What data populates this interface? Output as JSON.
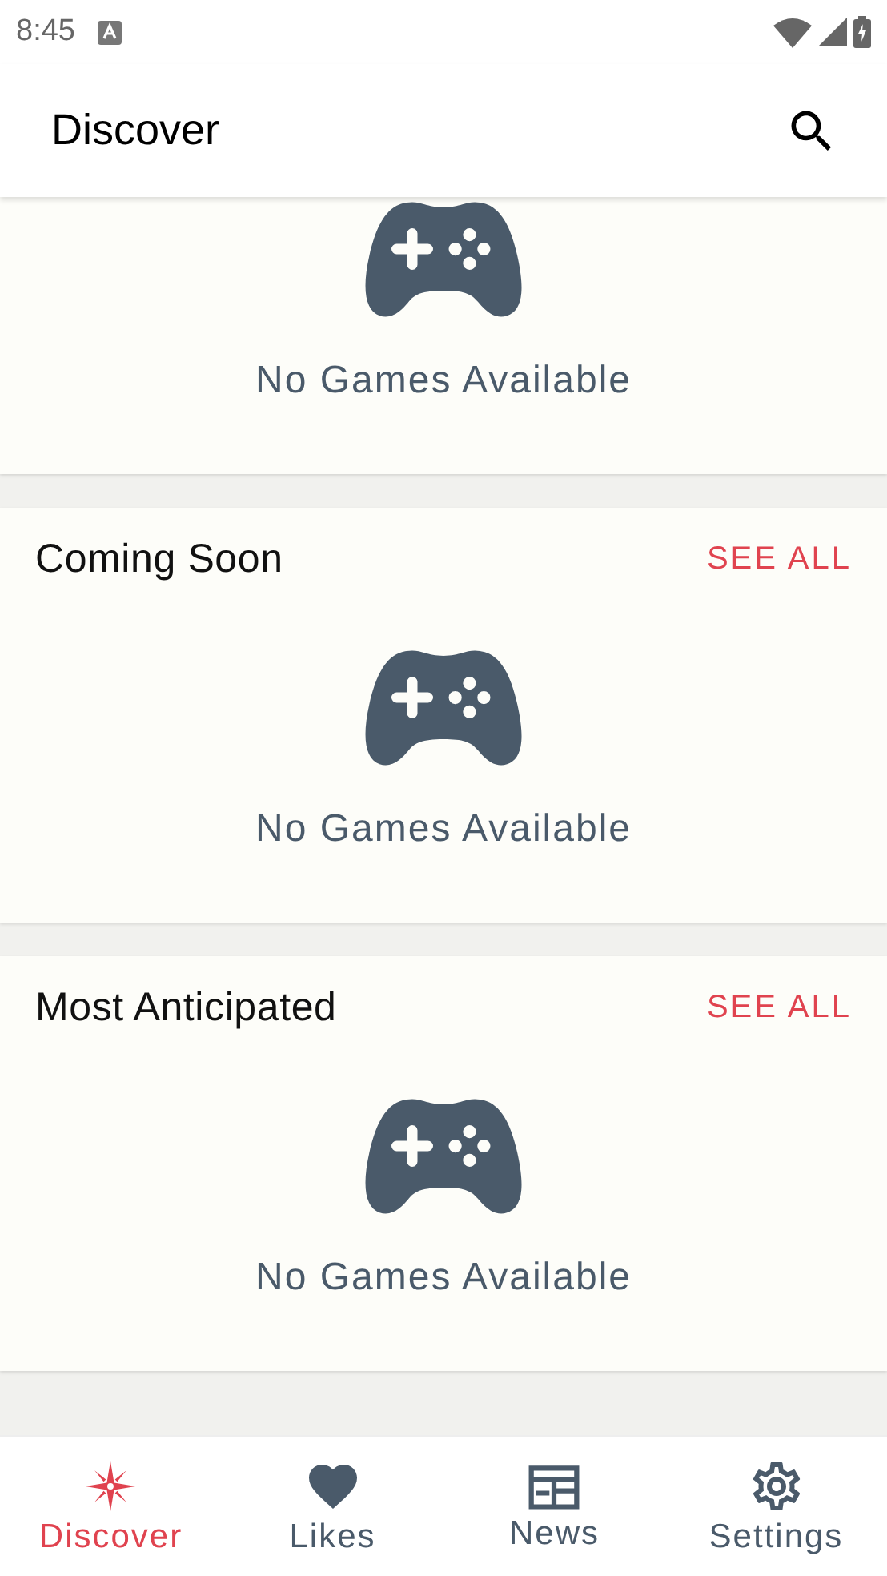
{
  "status_bar": {
    "time": "8:45"
  },
  "app_bar": {
    "title": "Discover"
  },
  "sections": [
    {
      "empty_text": "No Games Available"
    },
    {
      "title": "Coming Soon",
      "action": "SEE ALL",
      "empty_text": "No Games Available"
    },
    {
      "title": "Most Anticipated",
      "action": "SEE ALL",
      "empty_text": "No Games Available"
    }
  ],
  "bottom_nav": [
    {
      "kind": "discover",
      "label": "Discover",
      "selected": true
    },
    {
      "kind": "likes",
      "label": "Likes",
      "selected": false
    },
    {
      "kind": "news",
      "label": "News",
      "selected": false
    },
    {
      "kind": "settings",
      "label": "Settings",
      "selected": false
    }
  ]
}
